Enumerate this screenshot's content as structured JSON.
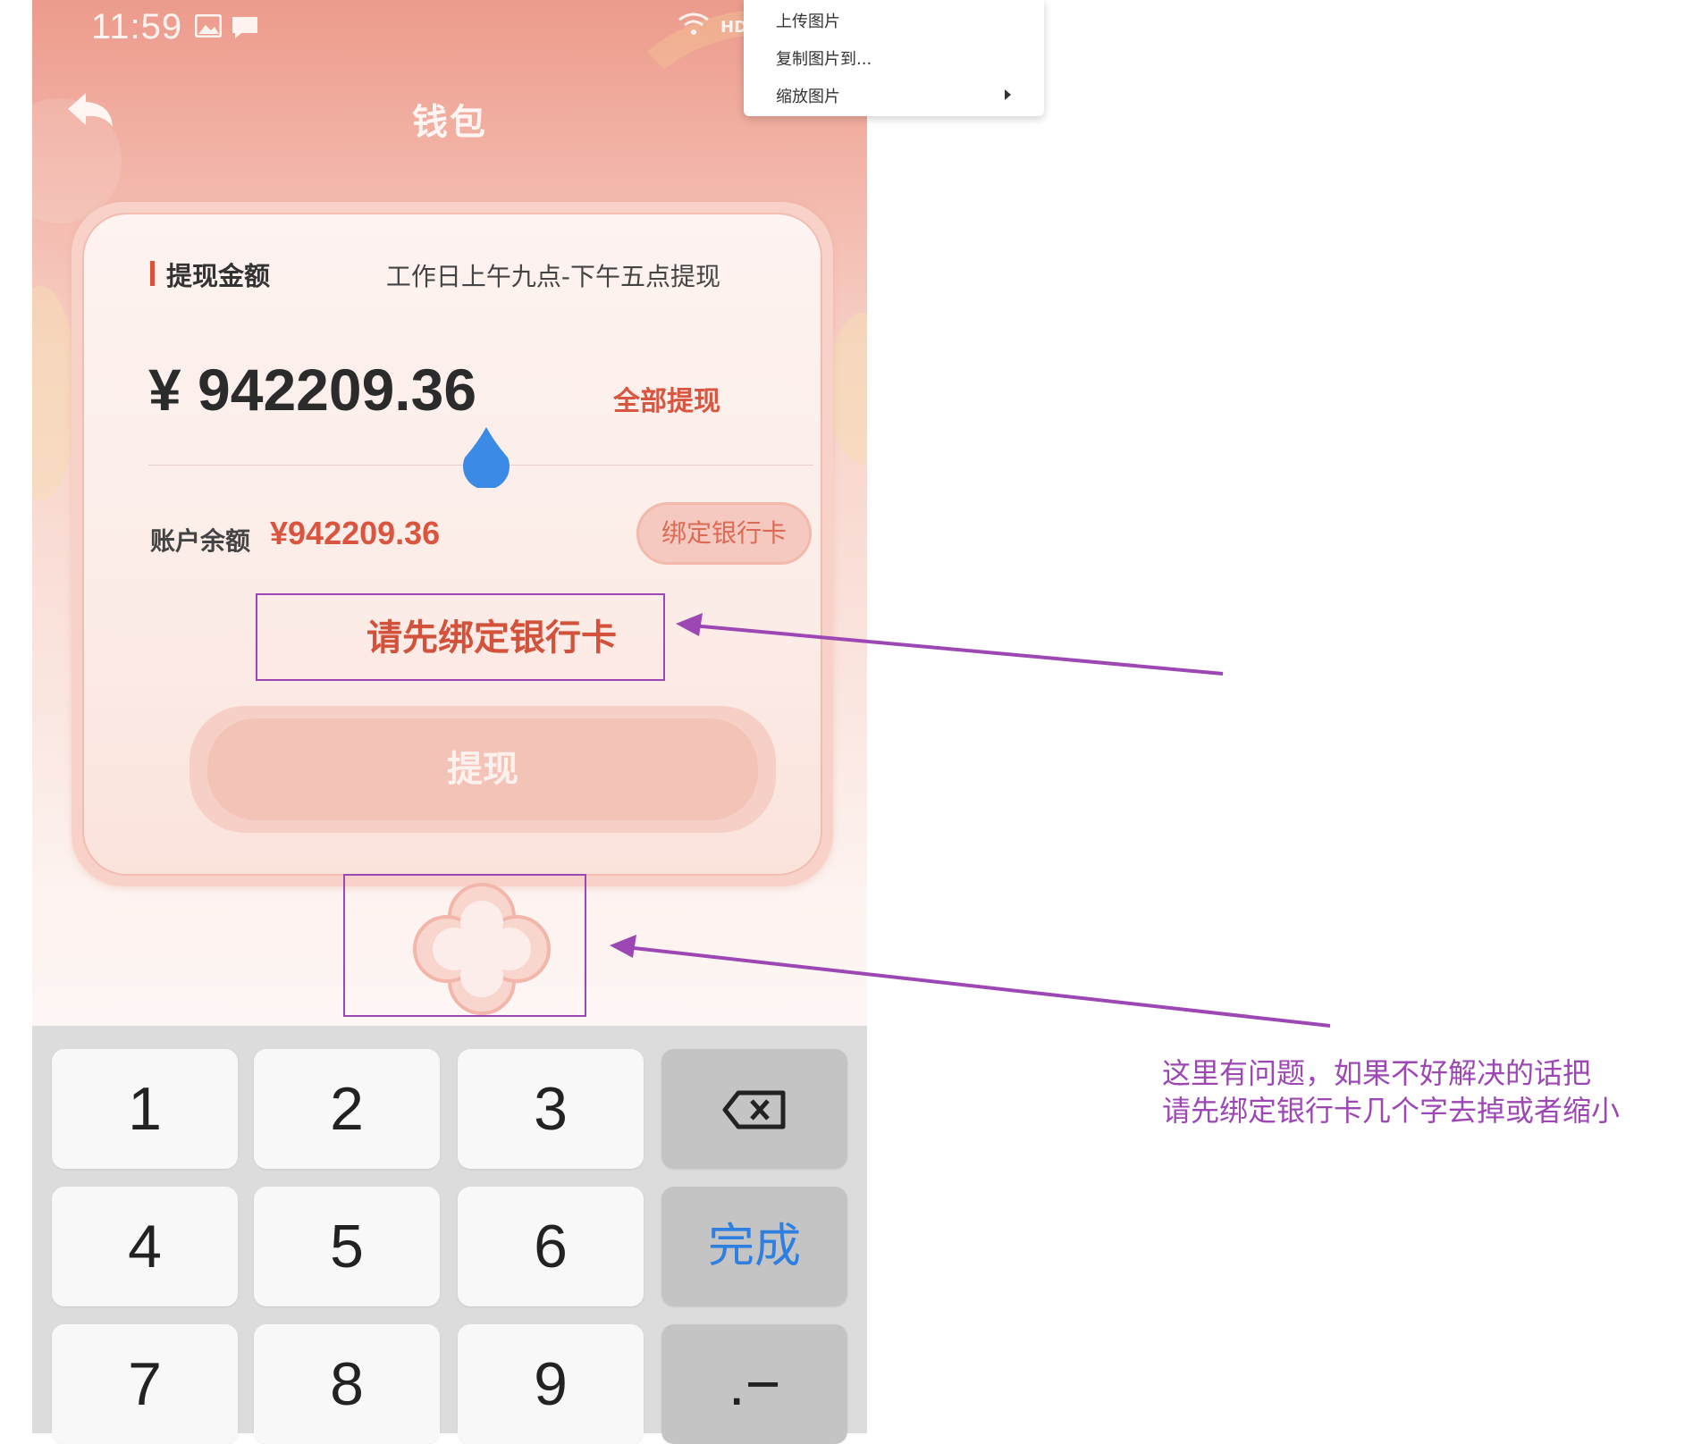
{
  "status_bar": {
    "time": "11:59",
    "network_label": "HD"
  },
  "header": {
    "title": "钱包"
  },
  "withdraw_card": {
    "section_title": "提现金额",
    "hint": "工作日上午九点-下午五点提现",
    "amount": "¥ 942209.36",
    "withdraw_all_label": "全部提现",
    "balance_label": "账户余额",
    "balance_value": "¥942209.36",
    "bind_card_button": "绑定银行卡",
    "bind_warning": "请先绑定银行卡",
    "submit_label": "提现"
  },
  "keyboard": {
    "keys": [
      "1",
      "2",
      "3",
      "4",
      "5",
      "6",
      "7",
      "8",
      "9"
    ],
    "done_label": "完成",
    "symbol_label": ".−"
  },
  "context_menu": {
    "items": [
      "上传图片",
      "复制图片到...",
      "缩放图片"
    ]
  },
  "annotation": {
    "line1": "这里有问题，如果不好解决的话把",
    "line2": "请先绑定银行卡几个字去掉或者缩小"
  },
  "colors": {
    "accent_red": "#d8553f",
    "annotation_purple": "#9d47b4",
    "done_blue": "#2e7fe0"
  }
}
